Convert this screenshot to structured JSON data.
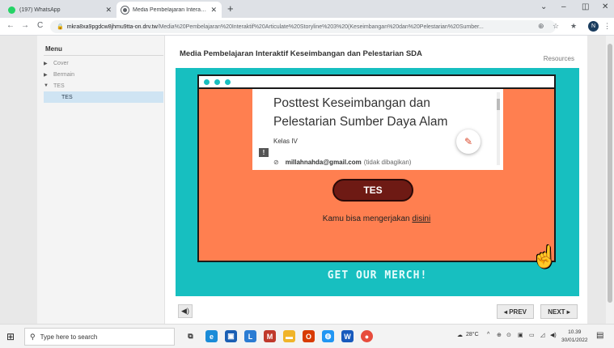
{
  "browser": {
    "tabs": [
      {
        "title": "(197) WhatsApp",
        "icon": "whatsapp-icon"
      },
      {
        "title": "Media Pembelajaran Interaktif Ke",
        "icon": "globe-icon"
      }
    ],
    "new_tab": "+",
    "window_controls": [
      "⌄",
      "–",
      "◫",
      "✕"
    ],
    "nav": {
      "back": "←",
      "forward": "→",
      "reload": "C"
    },
    "url_domain": "mkra8xa9pgdcw8jhmu9tta-on.drv.tw",
    "url_path": "/Media%20Pembelajaran%20Interaktif%20Articulate%20Storyline%203%20(Keseimbangan%20dan%20Pelestarian%20Sumber...",
    "extensions": [
      "⊕",
      "☆",
      "★"
    ],
    "profile_initial": "N"
  },
  "sidebar": {
    "title": "Menu",
    "items": [
      {
        "label": "Cover",
        "arrow": "▶"
      },
      {
        "label": "Bermain",
        "arrow": "▶"
      },
      {
        "label": "TES",
        "arrow": "▼"
      }
    ],
    "sub_items": [
      {
        "label": "TES"
      }
    ]
  },
  "slide_title": "Media Pembelajaran Interaktif Keseimbangan dan Pelestarian SDA",
  "resources_label": "Resources",
  "form": {
    "title": "Posttest Keseimbangan dan Pelestarian Sumber Daya Alam",
    "class": "Kelas IV",
    "email": "millahnahda@gmail.com",
    "not_shared": "(tidak dibagikan)"
  },
  "tes_button": "TES",
  "prompt_text": "Kamu bisa mengerjakan ",
  "prompt_link": "disini",
  "merch_text": "GET OUR MERCH!",
  "controls": {
    "prev": "◂ PREV",
    "next": "NEXT ▸",
    "volume": "◀)"
  },
  "taskbar": {
    "search_placeholder": "Type here to search",
    "weather": "28°C",
    "time": "10.39",
    "date": "30/01/2022"
  },
  "colors": {
    "slide_bg": "#17bfc0",
    "window_bg": "#ff7f50",
    "tes_button": "#6e1a14"
  }
}
